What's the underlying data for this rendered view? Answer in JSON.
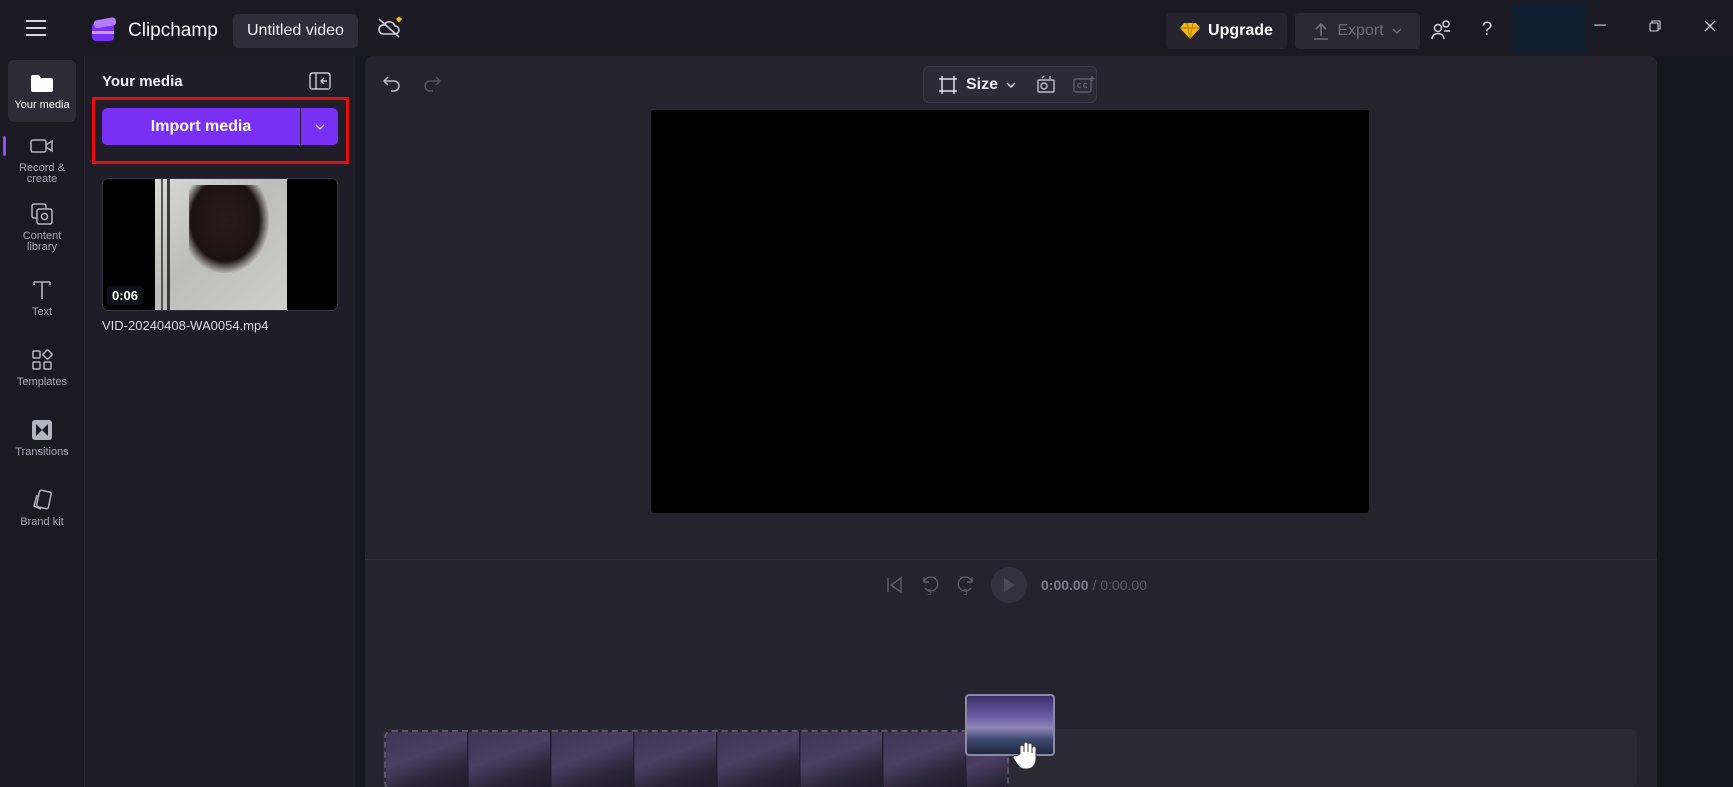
{
  "app": {
    "name": "Clipchamp",
    "project_title": "Untitled video",
    "upgrade_label": "Upgrade",
    "export_label": "Export",
    "accent": "#7a2ff4",
    "highlight": "#e80d0d"
  },
  "rail": {
    "items": [
      {
        "label": "Your media",
        "icon": "folder-icon"
      },
      {
        "label": "Record & create",
        "icon": "camera-icon"
      },
      {
        "label": "Content library",
        "icon": "library-icon"
      },
      {
        "label": "Text",
        "icon": "text-icon"
      },
      {
        "label": "Templates",
        "icon": "templates-icon"
      },
      {
        "label": "Transitions",
        "icon": "transitions-icon"
      },
      {
        "label": "Brand kit",
        "icon": "brand-kit-icon"
      }
    ]
  },
  "media_panel": {
    "title": "Your media",
    "import_label": "Import media",
    "items": [
      {
        "name": "VID-20240408-WA0054.mp4",
        "duration": "0:06"
      }
    ]
  },
  "editor": {
    "size_label": "Size",
    "time_current": "0:00.00",
    "time_total": "/ 0:00.00"
  }
}
